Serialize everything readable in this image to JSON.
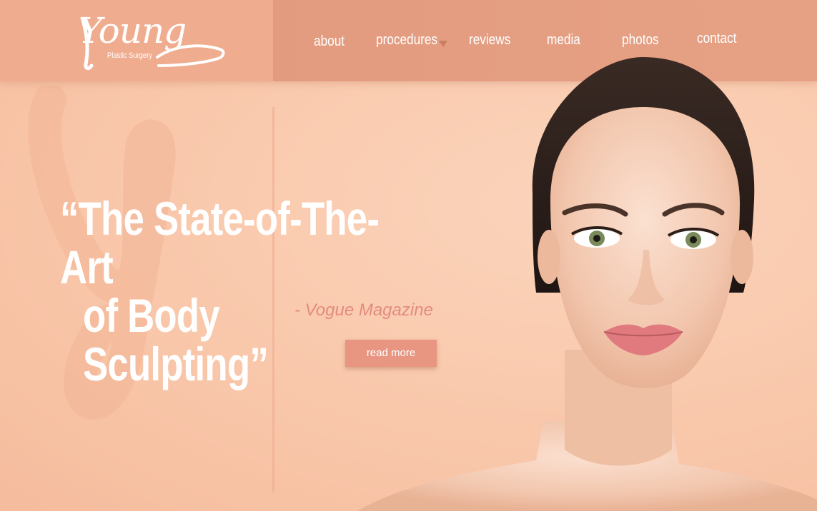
{
  "brand": {
    "name": "Young",
    "tagline": "Plastic Surgery"
  },
  "nav": {
    "items": [
      {
        "label": "about"
      },
      {
        "label": "procedures"
      },
      {
        "label": "reviews"
      },
      {
        "label": "media"
      },
      {
        "label": "photos"
      },
      {
        "label": "contact"
      }
    ]
  },
  "hero": {
    "quote_line1": "“The State-of-The-Art",
    "quote_line2": "of Body Sculpting”",
    "attribution": "- Vogue Magazine",
    "cta_label": "read more"
  },
  "colors": {
    "background": "#f9c9ac",
    "logo_bar": "#f0ac8e",
    "nav_bar": "#e39b7f",
    "accent_button": "#e89581",
    "attribution_text": "#e48b80"
  }
}
